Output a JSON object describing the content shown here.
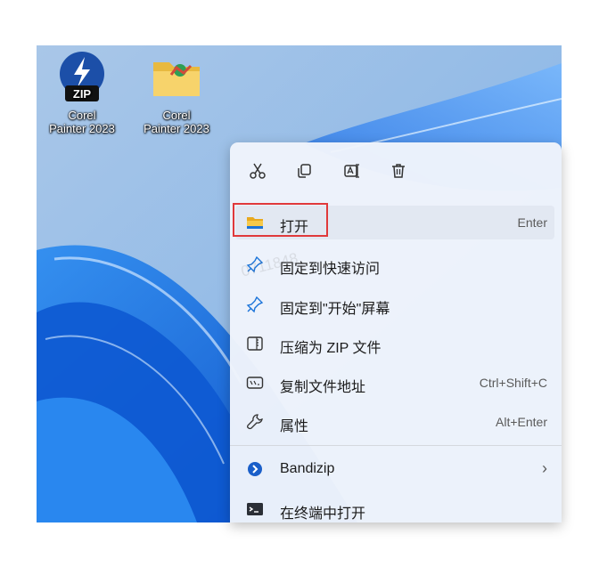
{
  "desktop": {
    "icons": [
      {
        "label_line1": "Corel",
        "label_line2": "Painter 2023",
        "icon": "zip-archive-icon",
        "badge": "ZIP"
      },
      {
        "label_line1": "Corel",
        "label_line2": "Painter 2023",
        "icon": "folder-icon"
      }
    ]
  },
  "quick_actions": [
    {
      "name": "cut-icon"
    },
    {
      "name": "copy-icon"
    },
    {
      "name": "rename-icon"
    },
    {
      "name": "delete-icon"
    }
  ],
  "menu_items": [
    {
      "label": "打开",
      "shortcut": "Enter",
      "icon": "folder-icon"
    },
    {
      "label": "固定到快速访问",
      "shortcut": "",
      "icon": "pin-icon"
    },
    {
      "label": "固定到\"开始\"屏幕",
      "shortcut": "",
      "icon": "pin-icon"
    },
    {
      "label": "压缩为 ZIP 文件",
      "shortcut": "",
      "icon": "zip-icon"
    },
    {
      "label": "复制文件地址",
      "shortcut": "Ctrl+Shift+C",
      "icon": "path-icon"
    },
    {
      "label": "属性",
      "shortcut": "Alt+Enter",
      "icon": "wrench-icon"
    },
    {
      "label": "Bandizip",
      "shortcut": "",
      "icon": "bandizip-icon",
      "submenu": "›"
    },
    {
      "label": "在终端中打开",
      "shortcut": "",
      "icon": "terminal-icon"
    }
  ],
  "watermark": "0711848",
  "colors": {
    "highlight_box": "#e0393b",
    "accent": "#1a73d9"
  }
}
